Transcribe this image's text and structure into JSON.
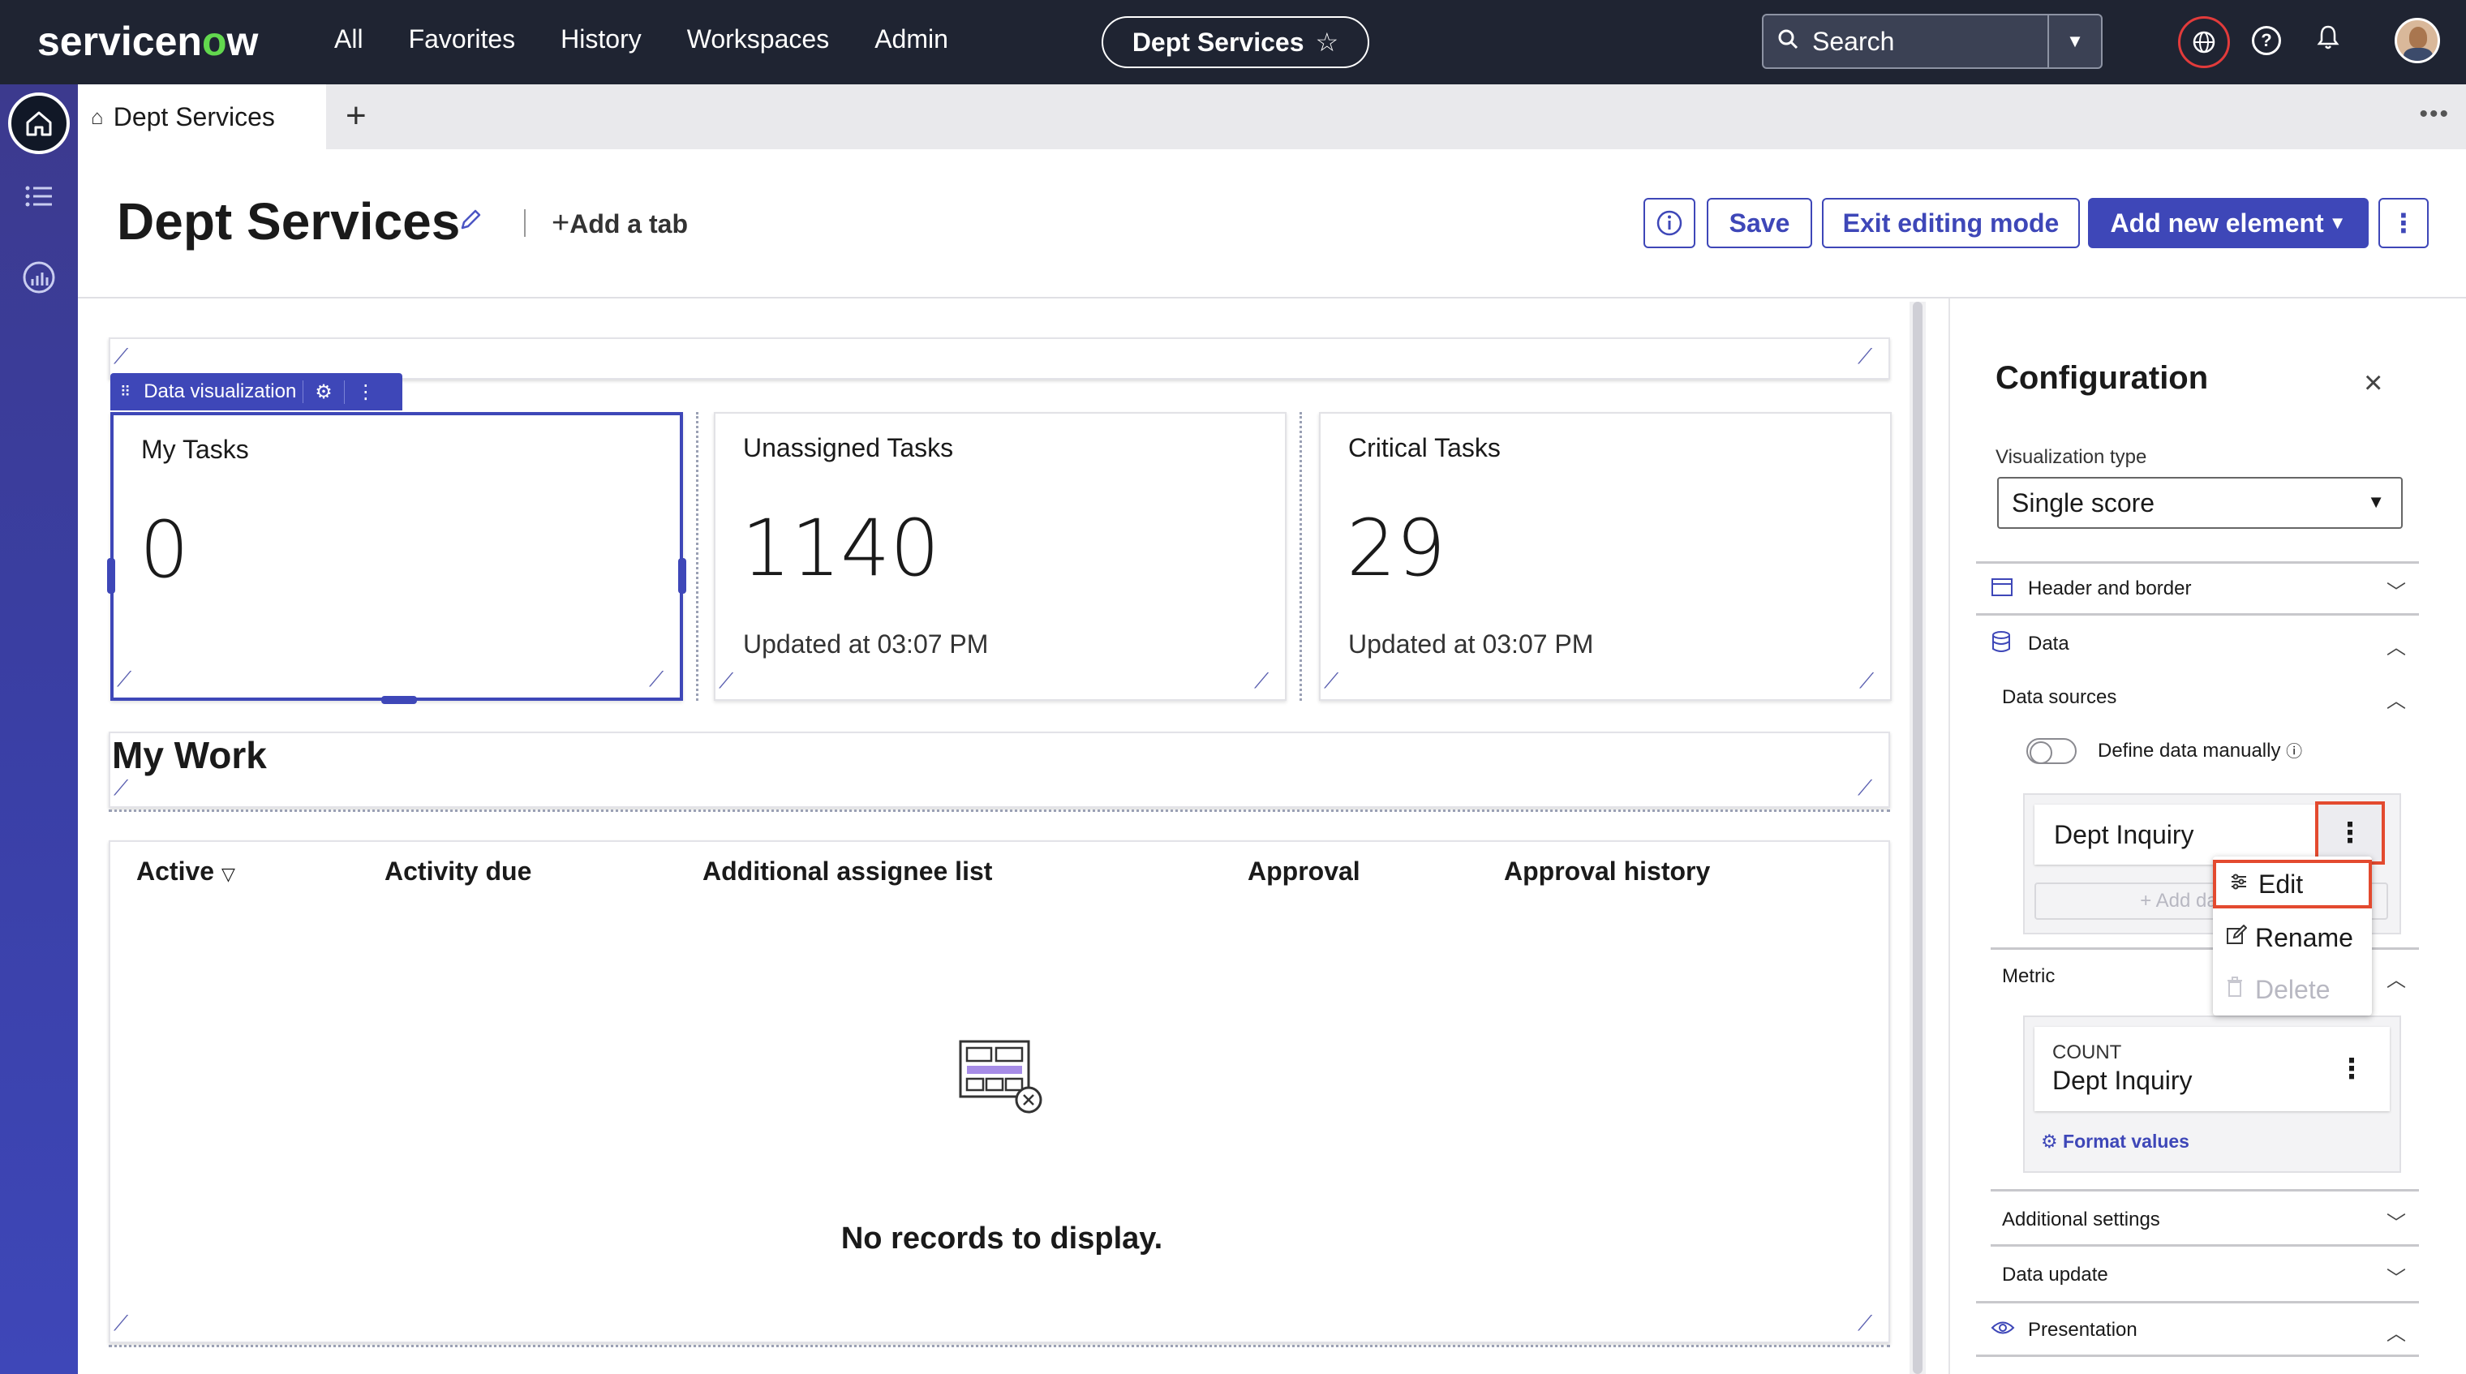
{
  "topnav": {
    "logo": "servicenow",
    "menu": [
      "All",
      "Favorites",
      "History",
      "Workspaces",
      "Admin"
    ],
    "workspace_pill": "Dept Services",
    "search_placeholder": "Search"
  },
  "tabs": {
    "active_tab": "Dept Services"
  },
  "page": {
    "title": "Dept Services",
    "add_tab": "Add a tab",
    "buttons": {
      "save": "Save",
      "exit": "Exit editing mode",
      "add_element": "Add new element"
    }
  },
  "canvas": {
    "dv_tag_label": "Data visualization",
    "score_cards": [
      {
        "title": "My Tasks",
        "value": "0",
        "updated": ""
      },
      {
        "title": "Unassigned Tasks",
        "value": "1140",
        "updated": "Updated at 03:07 PM"
      },
      {
        "title": "Critical Tasks",
        "value": "29",
        "updated": "Updated at 03:07 PM"
      }
    ],
    "mywork_title": "My Work",
    "table_columns": [
      "Active",
      "Activity due",
      "Additional assignee list",
      "Approval",
      "Approval history"
    ],
    "empty_message": "No records to display."
  },
  "config": {
    "title": "Configuration",
    "viz_type_label": "Visualization type",
    "viz_type_value": "Single score",
    "sections": {
      "header_border": "Header and border",
      "data": "Data",
      "data_sources": "Data sources",
      "define_manually": "Define data manually",
      "metric": "Metric",
      "additional": "Additional settings",
      "data_update": "Data update",
      "presentation": "Presentation"
    },
    "data_source_name": "Dept Inquiry",
    "add_data_source": "+ Add da",
    "menu": [
      "Edit",
      "Rename",
      "Delete"
    ],
    "metric_agg": "COUNT",
    "metric_name": "Dept Inquiry",
    "format_values": "Format values"
  },
  "colors": {
    "nav_bg": "#1f2432",
    "accent": "#3e47b8",
    "highlight": "#e34a2f"
  }
}
